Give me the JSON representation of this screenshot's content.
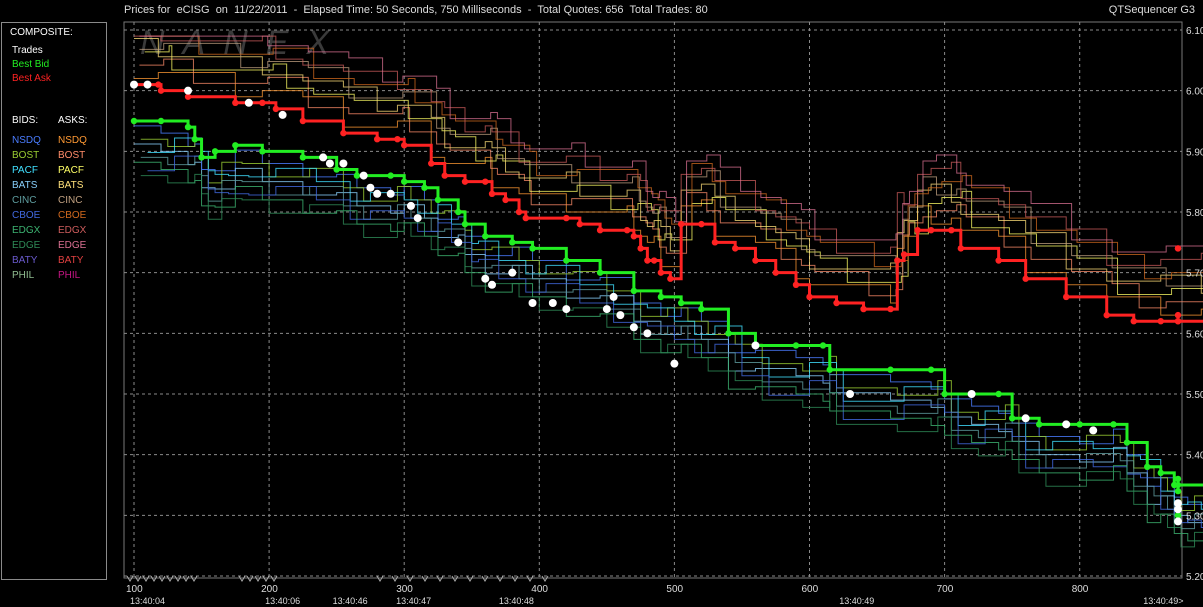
{
  "header": {
    "title": "Prices for  eCISG  on  11/22/2011  -  Elapsed Time: 50 Seconds, 750 Milliseconds  -  Total Quotes: 656  Total Trades: 80",
    "brand": "QTSequencer G3",
    "watermark": "NANEX"
  },
  "legend": {
    "composite_heading": "COMPOSITE:",
    "composite": [
      {
        "label": "Trades",
        "color": "#ffffff"
      },
      {
        "label": "Best Bid",
        "color": "#22ee22"
      },
      {
        "label": "Best Ask",
        "color": "#ff2222"
      }
    ],
    "bids_heading": "BIDS:",
    "asks_heading": "ASKS:",
    "exchanges": [
      {
        "bid": "NSDQ",
        "ask": "NSDQ",
        "bid_color": "#4a7cff",
        "ask_color": "#ff9933"
      },
      {
        "bid": "BOST",
        "ask": "BOST",
        "bid_color": "#9acd32",
        "ask_color": "#ff8c69"
      },
      {
        "bid": "PACF",
        "ask": "PACF",
        "bid_color": "#40e0ff",
        "ask_color": "#ffff66"
      },
      {
        "bid": "BATS",
        "ask": "BATS",
        "bid_color": "#87cefa",
        "ask_color": "#ffe07a"
      },
      {
        "bid": "CINC",
        "ask": "CINC",
        "bid_color": "#5f9ea0",
        "ask_color": "#c0a080"
      },
      {
        "bid": "CBOE",
        "ask": "CBOE",
        "bid_color": "#4169e1",
        "ask_color": "#d2691e"
      },
      {
        "bid": "EDGX",
        "ask": "EDGX",
        "bid_color": "#3cb371",
        "ask_color": "#cd5c5c"
      },
      {
        "bid": "EDGE",
        "ask": "EDGE",
        "bid_color": "#2e8b57",
        "ask_color": "#db7093"
      },
      {
        "bid": "BATY",
        "ask": "BATY",
        "bid_color": "#6a5acd",
        "ask_color": "#e04040"
      },
      {
        "bid": "PHIL",
        "ask": "PHIL",
        "bid_color": "#8fbc8f",
        "ask_color": "#c71585"
      }
    ]
  },
  "chart_data": {
    "type": "line",
    "ylim": [
      5.2,
      6.1
    ],
    "xlim": [
      100,
      880
    ],
    "y_ticks": [
      "5.20",
      "5.30",
      "5.40",
      "5.50",
      "5.60",
      "5.70",
      "5.80",
      "5.90",
      "6.00",
      "6.10"
    ],
    "x_ticks": [
      "100",
      "200",
      "300",
      "400",
      "500",
      "600",
      "700",
      "800"
    ],
    "x_tick_values": [
      100,
      200,
      300,
      400,
      500,
      600,
      700,
      800
    ],
    "time_labels": [
      {
        "x": 100,
        "label": "13:40:04"
      },
      {
        "x": 200,
        "label": "13:40:06"
      },
      {
        "x": 250,
        "label": "13:40:46"
      },
      {
        "x": 297,
        "label": "13:40:47"
      },
      {
        "x": 373,
        "label": "13:40:48"
      },
      {
        "x": 625,
        "label": "13:40:49"
      },
      {
        "x": 850,
        "label": "13:40:49>"
      }
    ],
    "grid": true,
    "series": [
      {
        "name": "Best Ask",
        "points": [
          [
            100,
            6.01
          ],
          [
            118,
            6.01
          ],
          [
            120,
            6.0
          ],
          [
            140,
            5.99
          ],
          [
            175,
            5.98
          ],
          [
            195,
            5.98
          ],
          [
            205,
            5.97
          ],
          [
            225,
            5.95
          ],
          [
            255,
            5.93
          ],
          [
            280,
            5.92
          ],
          [
            295,
            5.92
          ],
          [
            300,
            5.91
          ],
          [
            320,
            5.88
          ],
          [
            330,
            5.86
          ],
          [
            345,
            5.85
          ],
          [
            360,
            5.85
          ],
          [
            365,
            5.83
          ],
          [
            375,
            5.82
          ],
          [
            385,
            5.8
          ],
          [
            390,
            5.79
          ],
          [
            420,
            5.79
          ],
          [
            430,
            5.78
          ],
          [
            445,
            5.77
          ],
          [
            465,
            5.77
          ],
          [
            470,
            5.76
          ],
          [
            475,
            5.74
          ],
          [
            480,
            5.72
          ],
          [
            485,
            5.72
          ],
          [
            490,
            5.7
          ],
          [
            497,
            5.69
          ],
          [
            505,
            5.78
          ],
          [
            520,
            5.78
          ],
          [
            530,
            5.75
          ],
          [
            545,
            5.74
          ],
          [
            560,
            5.72
          ],
          [
            575,
            5.7
          ],
          [
            590,
            5.68
          ],
          [
            600,
            5.66
          ],
          [
            620,
            5.65
          ],
          [
            640,
            5.64
          ],
          [
            660,
            5.64
          ],
          [
            665,
            5.72
          ],
          [
            670,
            5.73
          ],
          [
            680,
            5.77
          ],
          [
            690,
            5.77
          ],
          [
            705,
            5.77
          ],
          [
            712,
            5.74
          ],
          [
            740,
            5.72
          ],
          [
            760,
            5.69
          ],
          [
            790,
            5.66
          ],
          [
            820,
            5.63
          ],
          [
            840,
            5.62
          ],
          [
            860,
            5.62
          ],
          [
            890,
            5.62
          ],
          [
            925,
            5.62
          ],
          [
            935,
            5.63
          ],
          [
            940,
            5.74
          ],
          [
            980,
            5.74
          ]
        ]
      },
      {
        "name": "Best Bid",
        "points": [
          [
            100,
            5.95
          ],
          [
            120,
            5.95
          ],
          [
            140,
            5.94
          ],
          [
            145,
            5.92
          ],
          [
            150,
            5.89
          ],
          [
            160,
            5.9
          ],
          [
            175,
            5.91
          ],
          [
            195,
            5.9
          ],
          [
            225,
            5.89
          ],
          [
            250,
            5.87
          ],
          [
            265,
            5.86
          ],
          [
            290,
            5.86
          ],
          [
            300,
            5.85
          ],
          [
            315,
            5.84
          ],
          [
            325,
            5.82
          ],
          [
            340,
            5.8
          ],
          [
            345,
            5.78
          ],
          [
            360,
            5.76
          ],
          [
            380,
            5.75
          ],
          [
            395,
            5.74
          ],
          [
            420,
            5.72
          ],
          [
            445,
            5.7
          ],
          [
            470,
            5.67
          ],
          [
            490,
            5.66
          ],
          [
            505,
            5.65
          ],
          [
            520,
            5.64
          ],
          [
            540,
            5.6
          ],
          [
            560,
            5.58
          ],
          [
            590,
            5.58
          ],
          [
            610,
            5.58
          ],
          [
            615,
            5.54
          ],
          [
            660,
            5.54
          ],
          [
            690,
            5.54
          ],
          [
            700,
            5.5
          ],
          [
            720,
            5.5
          ],
          [
            740,
            5.5
          ],
          [
            750,
            5.46
          ],
          [
            770,
            5.45
          ],
          [
            800,
            5.45
          ],
          [
            825,
            5.45
          ],
          [
            835,
            5.42
          ],
          [
            850,
            5.38
          ],
          [
            860,
            5.37
          ],
          [
            870,
            5.35
          ],
          [
            880,
            5.35
          ],
          [
            905,
            5.34
          ],
          [
            920,
            5.3
          ],
          [
            940,
            5.3
          ],
          [
            950,
            5.29
          ],
          [
            960,
            5.31
          ],
          [
            975,
            5.31
          ],
          [
            980,
            5.36
          ]
        ]
      },
      {
        "name": "Trades",
        "points": [
          [
            100,
            6.01
          ],
          [
            110,
            6.01
          ],
          [
            140,
            6.0
          ],
          [
            185,
            5.98
          ],
          [
            210,
            5.96
          ],
          [
            240,
            5.89
          ],
          [
            245,
            5.88
          ],
          [
            255,
            5.88
          ],
          [
            270,
            5.86
          ],
          [
            275,
            5.84
          ],
          [
            280,
            5.83
          ],
          [
            290,
            5.83
          ],
          [
            305,
            5.81
          ],
          [
            310,
            5.79
          ],
          [
            340,
            5.75
          ],
          [
            360,
            5.69
          ],
          [
            365,
            5.68
          ],
          [
            380,
            5.7
          ],
          [
            395,
            5.65
          ],
          [
            410,
            5.65
          ],
          [
            420,
            5.64
          ],
          [
            450,
            5.64
          ],
          [
            455,
            5.66
          ],
          [
            460,
            5.63
          ],
          [
            470,
            5.61
          ],
          [
            480,
            5.6
          ],
          [
            500,
            5.55
          ],
          [
            560,
            5.58
          ],
          [
            630,
            5.5
          ],
          [
            720,
            5.5
          ],
          [
            760,
            5.46
          ],
          [
            790,
            5.45
          ],
          [
            810,
            5.44
          ],
          [
            950,
            5.31
          ],
          [
            980,
            5.29
          ],
          [
            990,
            5.32
          ]
        ]
      }
    ]
  }
}
